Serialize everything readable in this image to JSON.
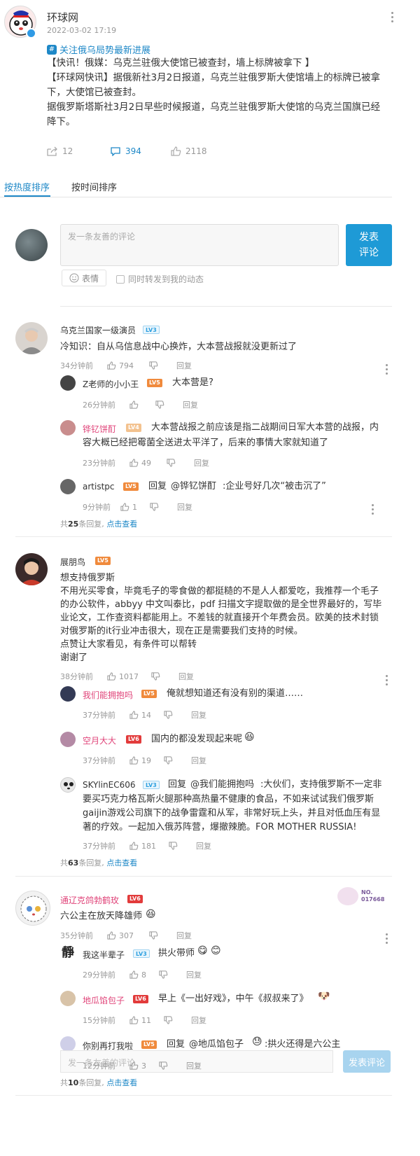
{
  "post": {
    "author": "环球网",
    "time": "2022-03-02 17:19",
    "topic": "关注俄乌局势最新进展",
    "lines": [
      "【快讯！俄媒：乌克兰驻俄大使馆已被查封，墙上标牌被拿下 】",
      "【环球网快讯】据俄新社3月2日报道，乌克兰驻俄罗斯大使馆墙上的标牌已被拿",
      "下，大使馆已被查封。",
      "据俄罗斯塔斯社3月2日早些时候报道，乌克兰驻俄罗斯大使馆的乌克兰国旗已经",
      "降下。"
    ],
    "stats": {
      "reposts": "12",
      "comments": "394",
      "likes": "2118"
    }
  },
  "tabs": {
    "hot": "按热度排序",
    "time": "按时间排序"
  },
  "composer": {
    "placeholder": "发一条友善的评论",
    "publish": "发表\n评论",
    "emoji": "表情",
    "repost": "同时转发到我的动态"
  },
  "comments": [
    {
      "user": "乌克兰国家一级演员",
      "level": "LV3",
      "text": "冷知识：自从乌信息战中心换炸，大本营战报就没更新过了",
      "time": "34分钟前",
      "likes": "794",
      "reply": "回复",
      "replies": [
        {
          "user": "Z老师的小小王",
          "level": "LV5",
          "text": "大本营是?",
          "time": "26分钟前",
          "likes": "",
          "reply": "回复"
        },
        {
          "user": "铧钇饼酊",
          "level": "LV4",
          "text_l1": "大本营战报之前应该是指二战期间日军大本营的战报，内",
          "text_l2": "容大概已经把霉菌全送进太平洋了，后来的事情大家就知道了",
          "time": "23分钟前",
          "likes": "49",
          "reply": "回复"
        },
        {
          "user": "artistpc",
          "level": "LV5",
          "prefix": "回复",
          "mention": "@铧钇饼酊",
          "text": ":企业号好几次“被击沉了”",
          "time": "9分钟前",
          "likes": "1",
          "reply": "回复"
        }
      ],
      "total_prefix": "共",
      "total_count": "25",
      "total_suffix": "条回复,",
      "total_link": "点击查看"
    },
    {
      "user": "展朋鸟",
      "level": "LV5",
      "lines": [
        "想支持俄罗斯",
        "不用光买零食，毕竟毛子的零食做的都挺糙的不是人人都爱吃，我推荐一个毛子",
        "的办公软件，abbyy 中文叫泰比，pdf 扫描文字提取做的是全世界最好的，写毕",
        "业论文，工作查资料都能用上。不差钱的就直接开个年费会员。欧美的技术封锁",
        "对俄罗斯的it行业冲击很大，现在正是需要我们支持的时候。",
        "点赞让大家看见，有条件可以帮转",
        "谢谢了"
      ],
      "time": "38分钟前",
      "likes": "1017",
      "reply": "回复",
      "replies": [
        {
          "user": "我们能拥抱吗",
          "level": "LV5",
          "text": "俺就想知道还有没有别的渠道……",
          "time": "37分钟前",
          "likes": "14",
          "reply": "回复"
        },
        {
          "user": "空月大大",
          "level": "LV6",
          "text": "国内的都没发现起来呢",
          "time": "37分钟前",
          "likes": "19",
          "reply": "回复"
        },
        {
          "user": "SKYlinEC606",
          "level": "LV3",
          "prefix": "回复",
          "mention": "@我们能拥抱吗",
          "text_l1": ":大伙们，支持俄罗斯不一定非",
          "text_l2": "要买巧克力格瓦斯火腿那种高热量不健康的食品，不如来试试我们俄罗斯",
          "text_l3": "gaijin游戏公司旗下的战争雷霆和从军，非常好玩上头，并且对低血压有显",
          "text_l4": "著的疗效。一起加入俄苏阵营，爆撤辣脆。FOR MOTHER RUSSIA!",
          "time": "37分钟前",
          "likes": "181",
          "reply": "回复"
        }
      ],
      "total_prefix": "共",
      "total_count": "63",
      "total_suffix": "条回复,",
      "total_link": "点击查看"
    },
    {
      "user": "通辽克鸽勃鹤玫",
      "level": "LV6",
      "text": "六公主在放天降雄师",
      "badge": "NO.\n017668",
      "time": "35分钟前",
      "likes": "307",
      "reply": "回复",
      "replies": [
        {
          "user": "我这半辈子",
          "level": "LV3",
          "text": "拱火带师",
          "time": "29分钟前",
          "likes": "8",
          "reply": "回复"
        },
        {
          "user": "地瓜馅包子",
          "level": "LV6",
          "text": "早上《一出好戏》，中午《叔叔来了》",
          "time": "15分钟前",
          "likes": "11",
          "reply": "回复"
        },
        {
          "user": "你别再打我啦",
          "level": "LV5",
          "prefix": "回复",
          "mention": "@地瓜馅包子",
          "text": ":拱火还得是六公主",
          "time": "12分钟前",
          "likes": "3",
          "reply": "回复"
        }
      ],
      "total_prefix": "共",
      "total_count": "10",
      "total_suffix": "条回复,",
      "total_link": "点击查看"
    }
  ],
  "bottom": {
    "placeholder": "发一条友善的评论",
    "button": "发表评论"
  },
  "colors": {
    "accent": "#1e88c7",
    "button": "#1e9ad6"
  }
}
